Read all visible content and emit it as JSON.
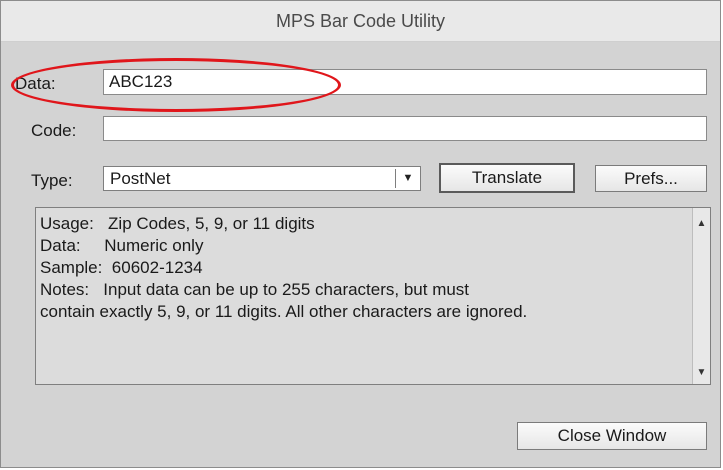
{
  "window": {
    "title": "MPS Bar Code Utility"
  },
  "form": {
    "data_label": "Data:",
    "data_value": "ABC123",
    "code_label": "Code:",
    "code_value": "",
    "type_label": "Type:",
    "type_selected": "PostNet"
  },
  "buttons": {
    "translate": "Translate",
    "prefs": "Prefs...",
    "close": "Close Window"
  },
  "notes": {
    "text": "Usage:   Zip Codes, 5, 9, or 11 digits\nData:     Numeric only\nSample:  60602-1234\nNotes:   Input data can be up to 255 characters, but must\ncontain exactly 5, 9, or 11 digits. All other characters are ignored."
  },
  "icons": {
    "dropdown": "chevron-down-icon",
    "scroll_up": "scroll-up-arrow-icon",
    "scroll_down": "scroll-down-arrow-icon"
  },
  "colors": {
    "highlight": "#e0161b",
    "window_bg": "#d3d3d3"
  }
}
